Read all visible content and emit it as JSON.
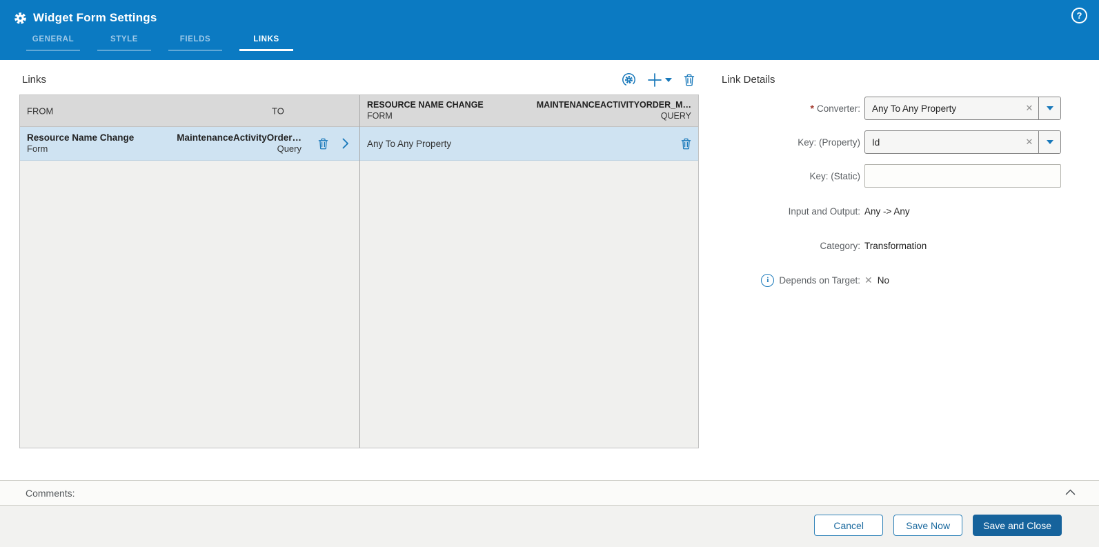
{
  "colors": {
    "header_bg": "#0b7ac2",
    "accent_blue": "#1878ba",
    "primary_button_bg": "#16639c",
    "selected_row_bg": "#cfe3f2",
    "table_header_bg": "#d9d9d9",
    "required_asterisk": "#a33a2e"
  },
  "glyphs": {
    "help": "?",
    "info": "i",
    "cross": "✕"
  },
  "header": {
    "title": "Widget Form Settings",
    "tabs": [
      {
        "label": "GENERAL",
        "active": false
      },
      {
        "label": "STYLE",
        "active": false
      },
      {
        "label": "FIELDS",
        "active": false
      },
      {
        "label": "LINKS",
        "active": true
      }
    ]
  },
  "links_panel": {
    "title": "Links",
    "toolbar_icons": [
      "auto-map-gear-icon",
      "add-icon",
      "add-menu-caret-icon",
      "delete-icon"
    ],
    "left_table": {
      "columns": [
        "FROM",
        "TO"
      ],
      "rows": [
        {
          "from_title": "Resource Name Change",
          "from_subtitle": "Form",
          "to_title": "MaintenanceActivityOrder…",
          "to_subtitle": "Query",
          "selected": true
        }
      ]
    },
    "right_table": {
      "header": {
        "from_title": "RESOURCE NAME CHANGE",
        "from_subtitle": "FORM",
        "to_title": "MAINTENANCEACTIVITYORDER_M…",
        "to_subtitle": "QUERY"
      },
      "rows": [
        {
          "converter": "Any To Any Property",
          "selected": true
        }
      ]
    }
  },
  "details_panel": {
    "title": "Link Details",
    "converter": {
      "required_marker": "*",
      "label": "Converter:",
      "value": "Any To Any Property"
    },
    "key_property": {
      "label": "Key: (Property)",
      "value": "Id"
    },
    "key_static": {
      "label": "Key: (Static)",
      "value": ""
    },
    "input_and_output": {
      "label": "Input and Output:",
      "value": "Any -> Any"
    },
    "category": {
      "label": "Category:",
      "value": "Transformation"
    },
    "depends_on_target": {
      "label": "Depends on Target:",
      "value": "No"
    }
  },
  "comments": {
    "label": "Comments:"
  },
  "footer": {
    "cancel_label": "Cancel",
    "save_now_label": "Save Now",
    "save_and_close_label": "Save and Close"
  }
}
